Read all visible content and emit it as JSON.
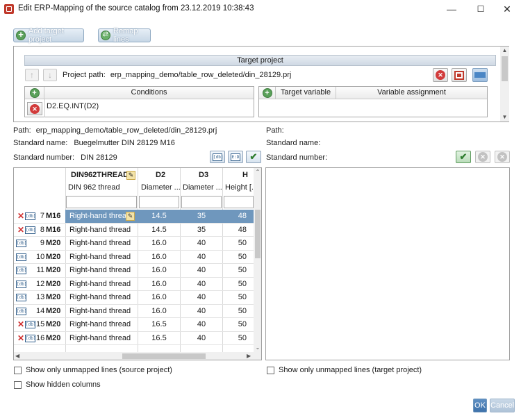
{
  "window": {
    "title": "Edit ERP-Mapping of the source catalog from 23.12.2019 10:38:43",
    "minimize": "—",
    "maximize": "☐",
    "close": "✕"
  },
  "toolbar": {
    "add_target_label": "Add target project",
    "remap_label": "Remap lines"
  },
  "target_panel": {
    "header": "Target project",
    "project_path_label": "Project path:",
    "project_path_value": "erp_mapping_demo/table_row_deleted/din_28129.prj",
    "conditions_header": "Conditions",
    "condition_value": "D2.EQ.INT(D2)",
    "target_variable_header": "Target variable",
    "variable_assignment_header": "Variable assignment"
  },
  "source_info": {
    "path_label": "Path:",
    "path_value": "erp_mapping_demo/table_row_deleted/din_28129.prj",
    "standard_name_label": "Standard name:",
    "standard_name_value": "Buegelmutter DIN 28129 M16",
    "standard_number_label": "Standard number:",
    "standard_number_value": "DIN 28129"
  },
  "target_info": {
    "path_label": "Path:",
    "standard_name_label": "Standard name:",
    "standard_number_label": "Standard number:"
  },
  "grid": {
    "columns": [
      {
        "name": "DIN962THREAD",
        "desc": "DIN 962 thread"
      },
      {
        "name": "D2",
        "desc": "Diameter ..."
      },
      {
        "name": "D3",
        "desc": "Diameter ..."
      },
      {
        "name": "H",
        "desc": "Height [..."
      }
    ],
    "rows": [
      {
        "status": "deleted",
        "num": "7",
        "size": "M16",
        "thread": "Right-hand thread",
        "d2": "14.5",
        "d3": "35",
        "h": "48",
        "selected": true
      },
      {
        "status": "deleted",
        "num": "8",
        "size": "M16",
        "thread": "Right-hand thread",
        "d2": "14.5",
        "d3": "35",
        "h": "48",
        "selected": false
      },
      {
        "status": "ok",
        "num": "9",
        "size": "M20",
        "thread": "Right-hand thread",
        "d2": "16.0",
        "d3": "40",
        "h": "50",
        "selected": false
      },
      {
        "status": "ok",
        "num": "10",
        "size": "M20",
        "thread": "Right-hand thread",
        "d2": "16.0",
        "d3": "40",
        "h": "50",
        "selected": false
      },
      {
        "status": "ok",
        "num": "11",
        "size": "M20",
        "thread": "Right-hand thread",
        "d2": "16.0",
        "d3": "40",
        "h": "50",
        "selected": false
      },
      {
        "status": "ok",
        "num": "12",
        "size": "M20",
        "thread": "Right-hand thread",
        "d2": "16.0",
        "d3": "40",
        "h": "50",
        "selected": false
      },
      {
        "status": "ok",
        "num": "13",
        "size": "M20",
        "thread": "Right-hand thread",
        "d2": "16.0",
        "d3": "40",
        "h": "50",
        "selected": false
      },
      {
        "status": "ok",
        "num": "14",
        "size": "M20",
        "thread": "Right-hand thread",
        "d2": "16.0",
        "d3": "40",
        "h": "50",
        "selected": false
      },
      {
        "status": "deleted",
        "num": "15",
        "size": "M20",
        "thread": "Right-hand thread",
        "d2": "16.5",
        "d3": "40",
        "h": "50",
        "selected": false
      },
      {
        "status": "deleted",
        "num": "16",
        "size": "M20",
        "thread": "Right-hand thread",
        "d2": "16.5",
        "d3": "40",
        "h": "50",
        "selected": false
      }
    ]
  },
  "options": {
    "unmapped_source": "Show only unmapped lines (source project)",
    "unmapped_target": "Show only unmapped lines (target project)",
    "hidden_columns": "Show hidden columns"
  },
  "footer": {
    "ok": "OK",
    "cancel": "Cancel"
  },
  "icons": {
    "db_glyph": "[db]",
    "sql_glyph": "E:D"
  }
}
